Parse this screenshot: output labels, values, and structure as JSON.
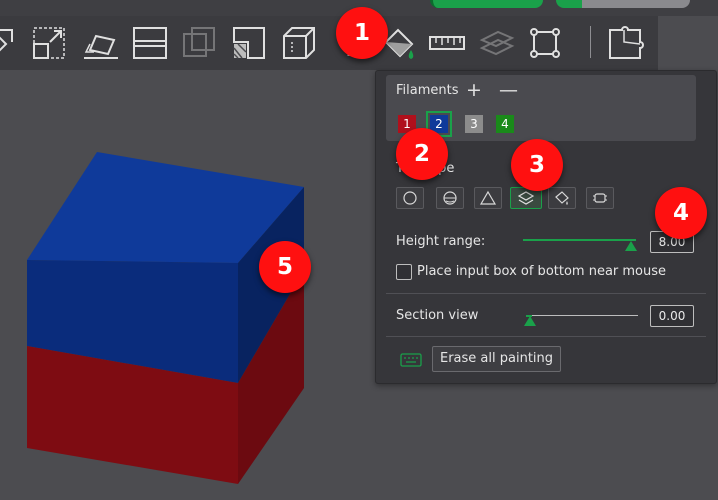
{
  "panel": {
    "filaments": {
      "title": "Filaments",
      "add_label": "+",
      "remove_label": "—",
      "swatches": [
        {
          "label": "1",
          "color": "#b0101c"
        },
        {
          "label": "2",
          "color": "#0f3a9a",
          "selected": true
        },
        {
          "label": "3",
          "color": "#8c8c8c"
        },
        {
          "label": "4",
          "color": "#1a8a1a"
        }
      ]
    },
    "tool_type_label": "Tool type",
    "tool_types": [
      "circle-tool-icon",
      "sphere-tool-icon",
      "triangle-tool-icon",
      "height-range-tool-icon",
      "fill-tool-icon",
      "gap-fill-tool-icon"
    ],
    "height_range": {
      "label": "Height range:",
      "value": "8.00"
    },
    "checkbox_label": "Place input box of bottom near mouse",
    "section_view": {
      "label": "Section view",
      "value": "0.00"
    },
    "erase_label": "Erase all painting"
  },
  "callouts": [
    "1",
    "2",
    "3",
    "4",
    "5"
  ],
  "colors": {
    "accent": "#1aa14a",
    "cube_top": "#0f3a9a",
    "cube_bottom": "#b0101c",
    "badge": "#ff1010"
  }
}
